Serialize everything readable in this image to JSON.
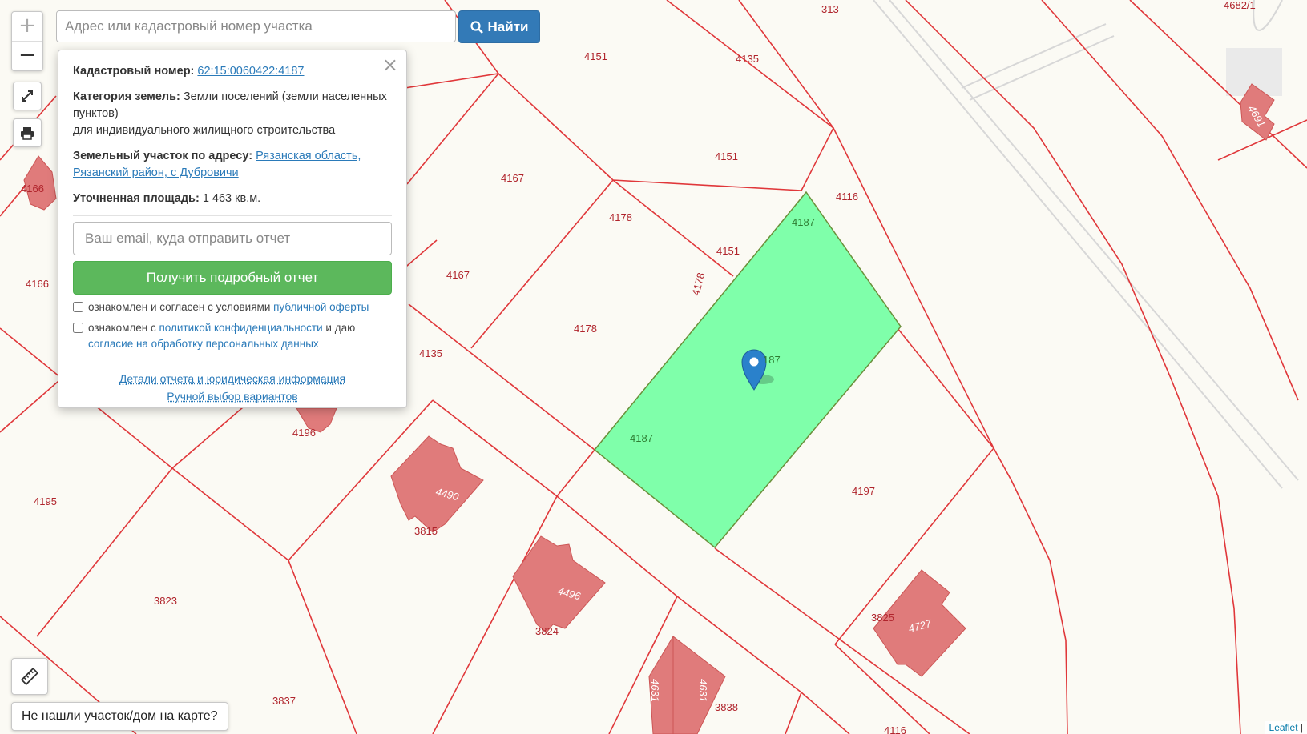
{
  "search": {
    "placeholder": "Адрес или кадастровый номер участка",
    "button_label": "Найти"
  },
  "zoom": {
    "in": "+",
    "out": "−"
  },
  "popup": {
    "cadastral_label": "Кадастровый номер:",
    "cadastral_number": "62:15:0060422:4187",
    "category_label": "Категория земель:",
    "category_value": "Земли поселений (земли населенных пунктов)",
    "usage": "для индивидуального жилищного строительства",
    "address_label": "Земельный участок по адресу:",
    "address_value": "Рязанская область, Рязанский район, с Дубровичи",
    "area_label": "Уточненная площадь:",
    "area_value": "1 463 кв.м.",
    "email_placeholder": "Ваш email, куда отправить отчет",
    "report_button": "Получить подробный отчет",
    "consent1_text": "ознакомлен и согласен с условиями",
    "consent1_link": "публичной оферты",
    "consent2_text": "ознакомлен с",
    "consent2_link": "политикой конфиденциальности",
    "consent2_text2": "и даю",
    "consent2_link2": "согласие на обработку персональных данных",
    "details_link": "Детали отчета и юридическая информация",
    "manual_link": "Ручной выбор вариантов",
    "close": "×"
  },
  "not_found_button": "Не нашли участок/дом на карте?",
  "attribution": {
    "leaflet": "Leaflet",
    "sep": " | "
  },
  "map": {
    "parcel_labels": [
      "313",
      "4682/1",
      "4151",
      "4135",
      "4151",
      "4116",
      "4167",
      "4178",
      "4151",
      "4178",
      "4167",
      "4166",
      "4166",
      "4178",
      "4135",
      "4196",
      "4195",
      "3815",
      "3823",
      "3824",
      "3825",
      "3837",
      "3838",
      "4197",
      "4116"
    ],
    "selected_labels": [
      "4187",
      "4187",
      "187"
    ],
    "building_labels": [
      "4490",
      "4496",
      "4727",
      "4691",
      "4631",
      "4631"
    ],
    "colors": {
      "parcel_line": "#e0373a",
      "selected_fill": "#7fffaa",
      "building_fill": "#e07b7b",
      "background": "#fbfaf4",
      "road_line": "#d7d7d7"
    }
  }
}
